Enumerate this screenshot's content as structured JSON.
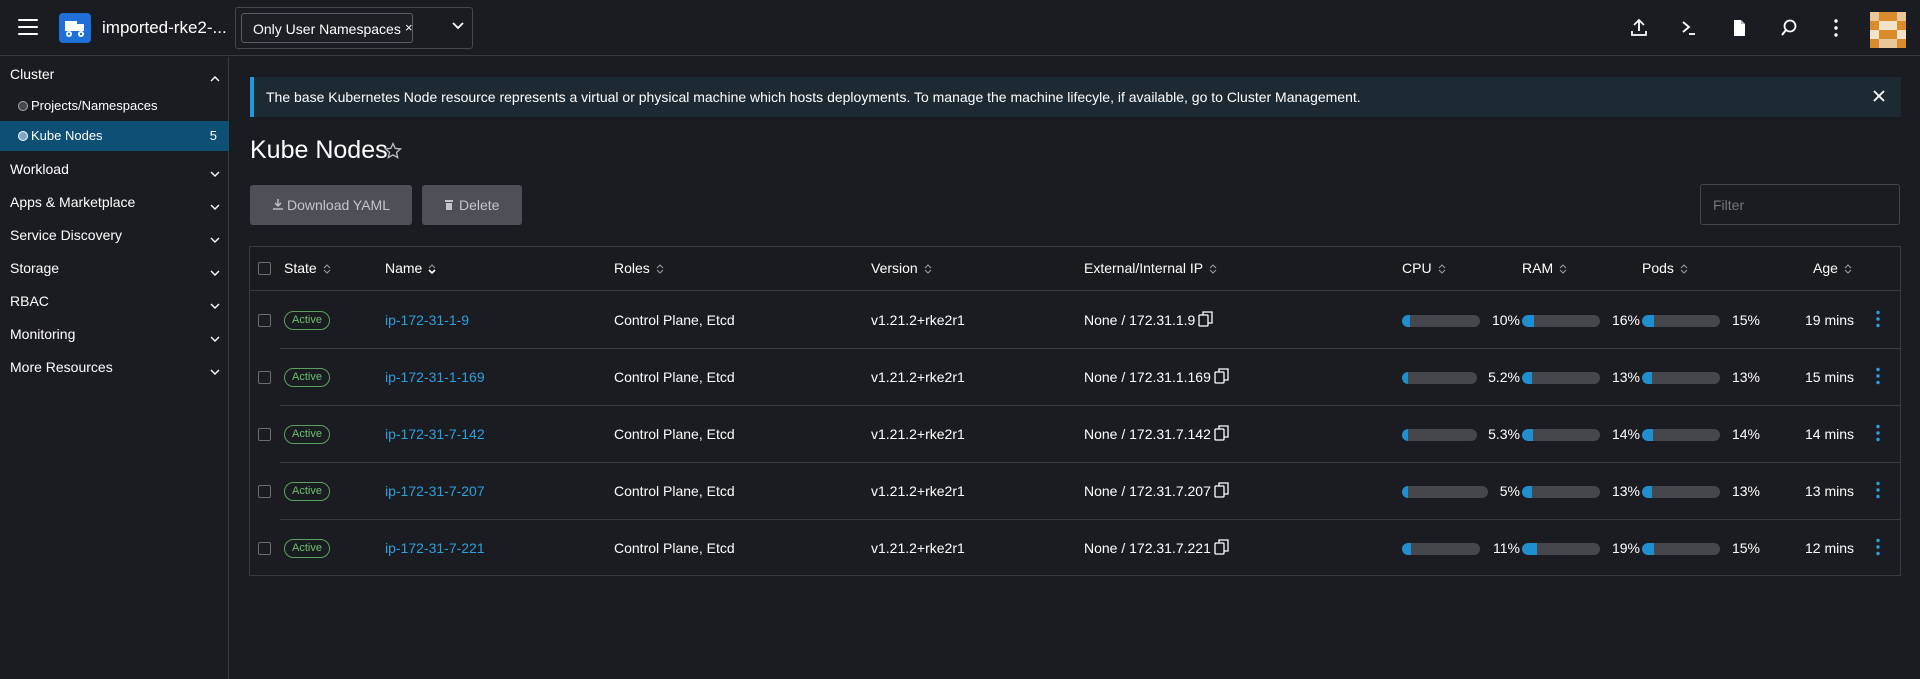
{
  "header": {
    "cluster_name": "imported-rke2-...",
    "namespace_chip": "Only User Namespaces",
    "namespace_chip_remove": "×"
  },
  "sidebar": {
    "groups": [
      {
        "label": "Cluster",
        "expanded": true
      },
      {
        "label": "Workload"
      },
      {
        "label": "Apps & Marketplace"
      },
      {
        "label": "Service Discovery"
      },
      {
        "label": "Storage"
      },
      {
        "label": "RBAC"
      },
      {
        "label": "Monitoring"
      },
      {
        "label": "More Resources"
      }
    ],
    "cluster_items": [
      {
        "label": "Projects/Namespaces",
        "count": ""
      },
      {
        "label": "Kube Nodes",
        "count": "5",
        "active": true
      }
    ]
  },
  "banner": {
    "text": "The base Kubernetes Node resource represents a virtual or physical machine which hosts deployments. To manage the machine lifecyle, if available, go to Cluster Management."
  },
  "page": {
    "title": "Kube Nodes",
    "download_label": "Download YAML",
    "delete_label": "Delete",
    "filter_placeholder": "Filter"
  },
  "table": {
    "columns": [
      "State",
      "Name",
      "Roles",
      "Version",
      "External/Internal IP",
      "CPU",
      "RAM",
      "Pods",
      "Age"
    ],
    "rows": [
      {
        "state": "Active",
        "name": "ip-172-31-1-9",
        "roles": "Control Plane, Etcd",
        "version": "v1.21.2+rke2r1",
        "ip": "None / 172.31.1.9",
        "cpu": "10%",
        "cpu_frac": 0.1,
        "ram": "16%",
        "ram_frac": 0.16,
        "pods": "15%",
        "pods_frac": 0.15,
        "age": "19 mins"
      },
      {
        "state": "Active",
        "name": "ip-172-31-1-169",
        "roles": "Control Plane, Etcd",
        "version": "v1.21.2+rke2r1",
        "ip": "None / 172.31.1.169",
        "cpu": "5.2%",
        "cpu_frac": 0.052,
        "ram": "13%",
        "ram_frac": 0.13,
        "pods": "13%",
        "pods_frac": 0.13,
        "age": "15 mins"
      },
      {
        "state": "Active",
        "name": "ip-172-31-7-142",
        "roles": "Control Plane, Etcd",
        "version": "v1.21.2+rke2r1",
        "ip": "None / 172.31.7.142",
        "cpu": "5.3%",
        "cpu_frac": 0.053,
        "ram": "14%",
        "ram_frac": 0.14,
        "pods": "14%",
        "pods_frac": 0.14,
        "age": "14 mins"
      },
      {
        "state": "Active",
        "name": "ip-172-31-7-207",
        "roles": "Control Plane, Etcd",
        "version": "v1.21.2+rke2r1",
        "ip": "None / 172.31.7.207",
        "cpu": "5%",
        "cpu_frac": 0.05,
        "ram": "13%",
        "ram_frac": 0.13,
        "pods": "13%",
        "pods_frac": 0.13,
        "age": "13 mins"
      },
      {
        "state": "Active",
        "name": "ip-172-31-7-221",
        "roles": "Control Plane, Etcd",
        "version": "v1.21.2+rke2r1",
        "ip": "None / 172.31.7.221",
        "cpu": "11%",
        "cpu_frac": 0.11,
        "ram": "19%",
        "ram_frac": 0.19,
        "pods": "15%",
        "pods_frac": 0.15,
        "age": "12 mins"
      }
    ]
  },
  "colors": {
    "accent": "#1e8fcf",
    "link": "#2aa1dd",
    "active_badge": "#6cc070",
    "background": "#1b1c21"
  }
}
